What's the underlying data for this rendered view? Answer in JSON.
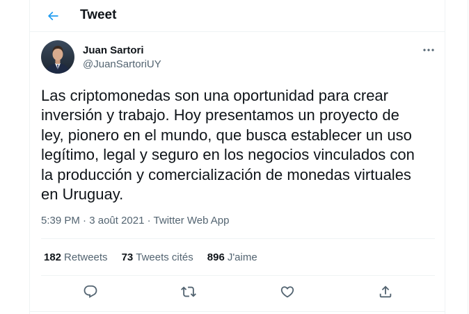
{
  "header": {
    "title": "Tweet",
    "back_icon": "back-arrow-icon"
  },
  "tweet": {
    "author": {
      "name": "Juan Sartori",
      "handle": "@JuanSartoriUY",
      "avatar": "profile-photo"
    },
    "text": "Las criptomonedas son una oportunidad para crear\ninversión y trabajo. Hoy presentamos un proyecto de\nley, pionero en el mundo, que busca establecer un uso\nlegítimo, legal y seguro en los negocios vinculados con\nla producción y comercialización de monedas virtuales\nen Uruguay.",
    "meta": {
      "time": "5:39 PM",
      "date": "3 août 2021",
      "separator": "·",
      "source": "Twitter Web App"
    },
    "stats": {
      "retweets_count": "182",
      "retweets_label": "Retweets",
      "quotes_count": "73",
      "quotes_label": "Tweets cités",
      "likes_count": "896",
      "likes_label": "J'aime"
    },
    "actions": [
      "reply-icon",
      "retweet-icon",
      "like-icon",
      "share-icon"
    ]
  },
  "colors": {
    "accent": "#1d9bf0",
    "text_primary": "#0f1419",
    "text_secondary": "#536471",
    "border": "#eff3f4"
  }
}
